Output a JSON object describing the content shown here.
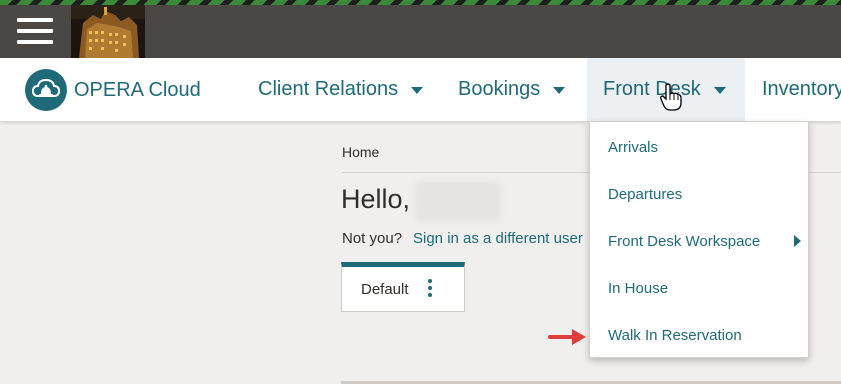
{
  "topbar": {
    "menu_icon": "hamburger-menu-icon",
    "hotel_image": "hotel-building-image"
  },
  "brand": {
    "logo_icon": "cloud-bell-icon",
    "name": "OPERA Cloud"
  },
  "nav": [
    {
      "label": "Client Relations",
      "has_caret": true
    },
    {
      "label": "Bookings",
      "has_caret": true
    },
    {
      "label": "Front Desk",
      "has_caret": true,
      "active": true
    },
    {
      "label": "Inventory"
    }
  ],
  "dropdown": {
    "items": [
      {
        "label": "Arrivals"
      },
      {
        "label": "Departures"
      },
      {
        "label": "Front Desk Workspace",
        "has_submenu": true
      },
      {
        "label": "In House"
      },
      {
        "label": "Walk In Reservation"
      }
    ]
  },
  "content": {
    "breadcrumb": "Home",
    "greeting": "Hello,",
    "not_you": "Not you?",
    "sign_in_link": "Sign in as a different user",
    "default_card": "Default"
  },
  "colors": {
    "accent": "#1f6a78",
    "topbar": "#4a4745",
    "annotation_arrow": "#e03c3c"
  }
}
